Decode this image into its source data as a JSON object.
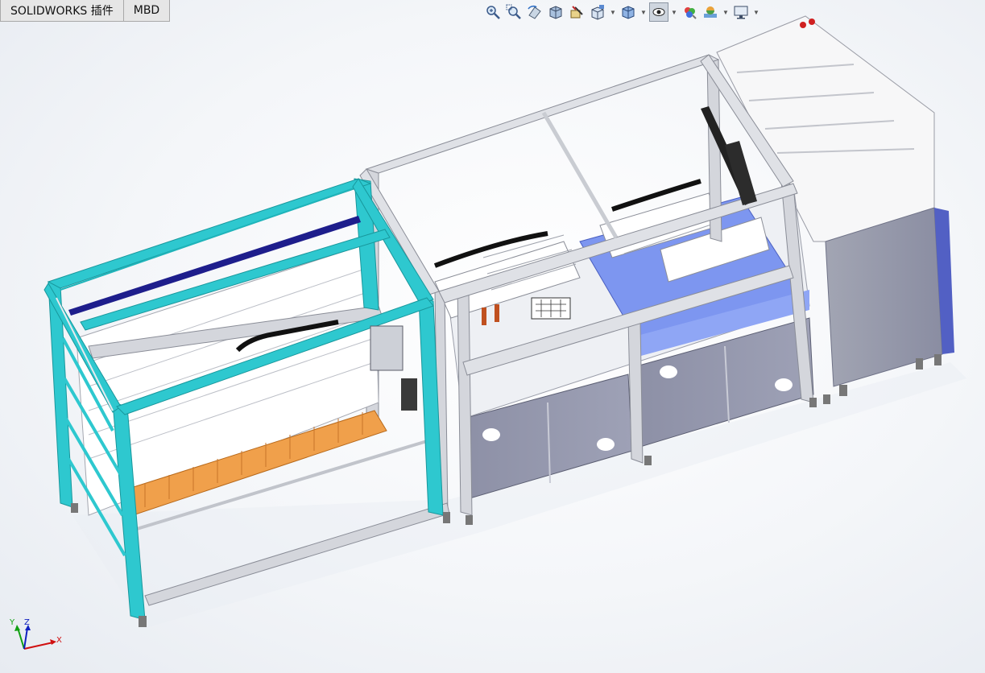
{
  "tabs": [
    {
      "label": "SOLIDWORKS 插件"
    },
    {
      "label": "MBD"
    }
  ],
  "heads_up_toolbar": {
    "buttons": [
      {
        "icon": "zoom-to-fit-icon"
      },
      {
        "icon": "zoom-to-area-icon"
      },
      {
        "icon": "previous-view-icon"
      },
      {
        "icon": "section-view-icon"
      },
      {
        "icon": "dynamic-annotation-icon"
      },
      {
        "icon": "view-orientation-icon"
      },
      {
        "icon": "display-style-icon"
      },
      {
        "icon": "hide-show-items-icon"
      },
      {
        "icon": "edit-appearance-icon"
      },
      {
        "icon": "apply-scene-icon"
      },
      {
        "icon": "view-settings-icon"
      }
    ]
  },
  "triad": {
    "x_label": "X",
    "y_label": "Y",
    "z_label": "Z"
  },
  "colors": {
    "background": "#f4f6f9",
    "frame_cyan": "#2ec8cf",
    "frame_gray": "#c9ccd2",
    "cabinet_panel": "#8e92a8",
    "blue_plate": "#7d96f0",
    "trays_orange": "#f0a04b",
    "rail_dark_blue": "#1e1e8c",
    "x_axis": "#d01010",
    "y_axis": "#10a010",
    "z_axis": "#1020c0"
  }
}
